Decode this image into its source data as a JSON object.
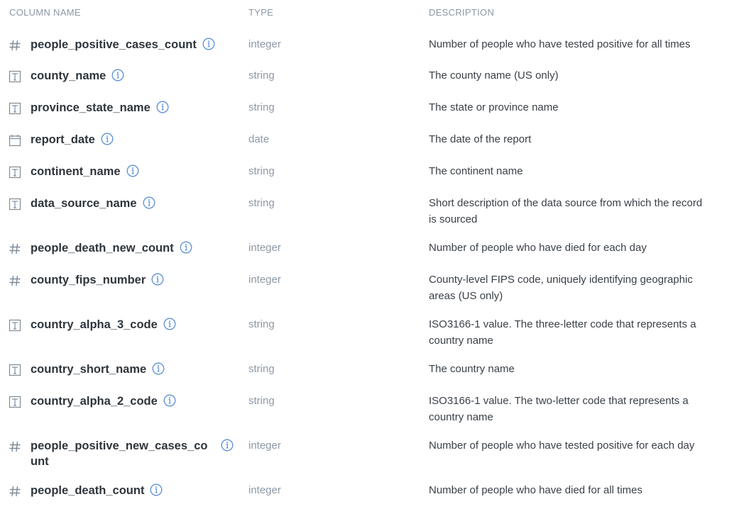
{
  "header": {
    "name": "COLUMN NAME",
    "type": "TYPE",
    "description": "DESCRIPTION"
  },
  "rows": [
    {
      "icon": "number-icon",
      "name": "people_positive_cases_count",
      "type": "integer",
      "description": "Number of people who have tested positive for all times"
    },
    {
      "icon": "text-icon",
      "name": "county_name",
      "type": "string",
      "description": "The county name (US only)"
    },
    {
      "icon": "text-icon",
      "name": "province_state_name",
      "type": "string",
      "description": "The state or province name"
    },
    {
      "icon": "calendar-icon",
      "name": "report_date",
      "type": "date",
      "description": "The date of the report"
    },
    {
      "icon": "text-icon",
      "name": "continent_name",
      "type": "string",
      "description": "The continent name"
    },
    {
      "icon": "text-icon",
      "name": "data_source_name",
      "type": "string",
      "description": "Short description of the data source from which the record is sourced"
    },
    {
      "icon": "number-icon",
      "name": "people_death_new_count",
      "type": "integer",
      "description": "Number of people who have died for each day"
    },
    {
      "icon": "number-icon",
      "name": "county_fips_number",
      "type": "integer",
      "description": "County-level FIPS code, uniquely identifying geographic areas (US only)"
    },
    {
      "icon": "text-icon",
      "name": "country_alpha_3_code",
      "type": "string",
      "description": "ISO3166-1 value. The three-letter code that represents a country name"
    },
    {
      "icon": "text-icon",
      "name": "country_short_name",
      "type": "string",
      "description": "The country name"
    },
    {
      "icon": "text-icon",
      "name": "country_alpha_2_code",
      "type": "string",
      "description": "ISO3166-1 value. The two-letter code that represents a country name"
    },
    {
      "icon": "number-icon",
      "name": "people_positive_new_cases_count",
      "type": "integer",
      "description": "Number of people who have tested positive for each day"
    },
    {
      "icon": "number-icon",
      "name": "people_death_count",
      "type": "integer",
      "description": "Number of people who have died for all times"
    }
  ]
}
